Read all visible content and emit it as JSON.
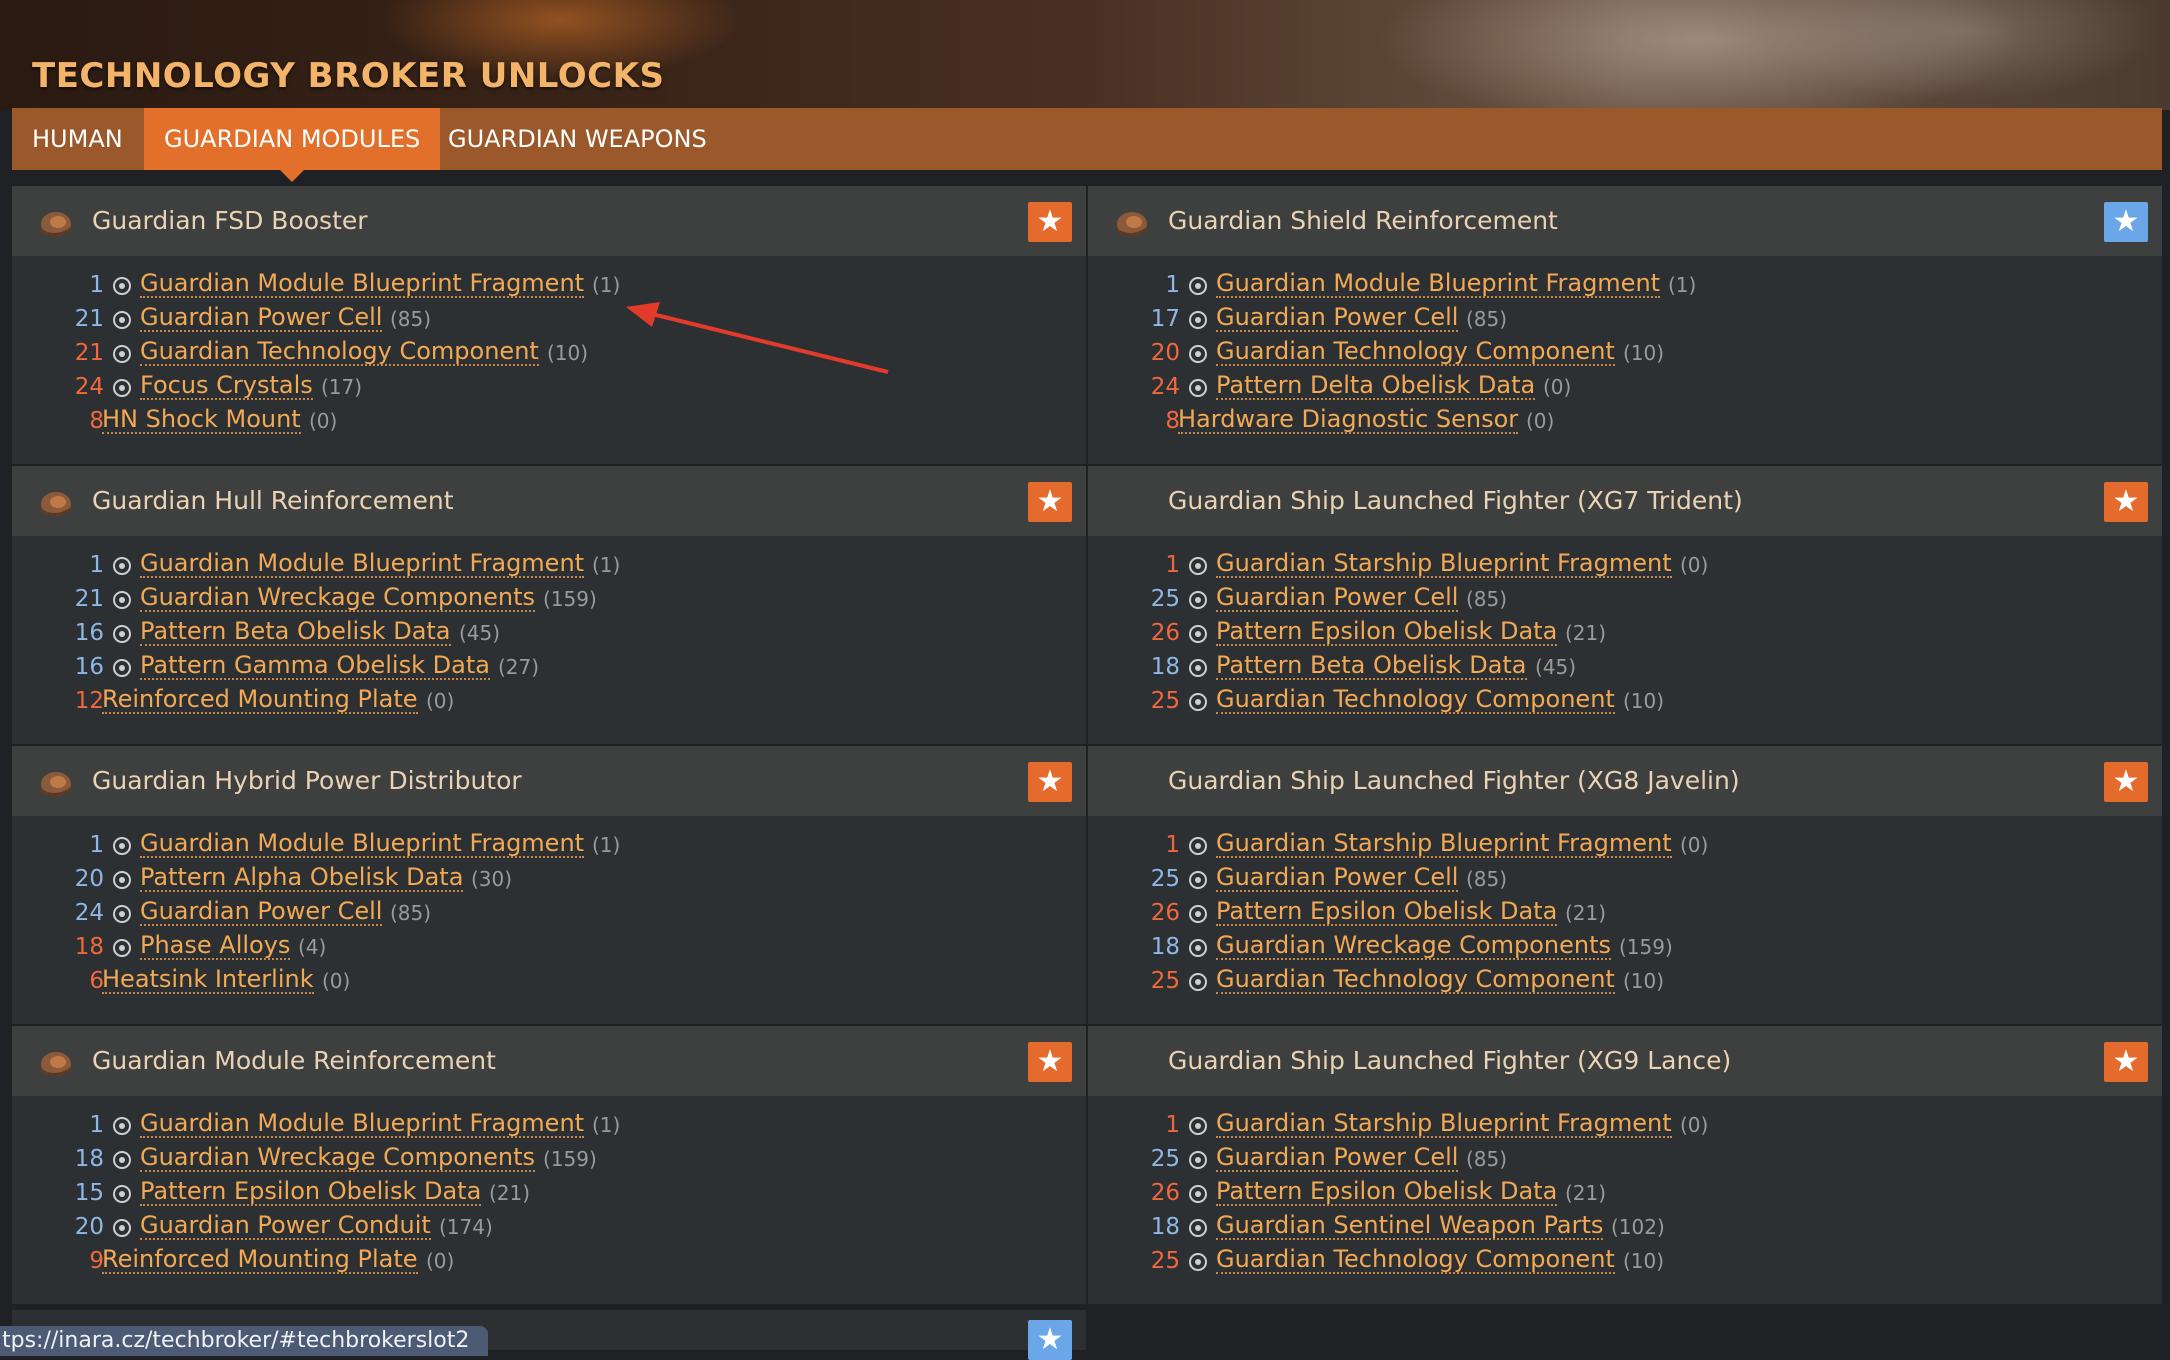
{
  "header": {
    "title": "TECHNOLOGY BROKER UNLOCKS"
  },
  "tabs": [
    {
      "label": "HUMAN",
      "active": false
    },
    {
      "label": "GUARDIAN MODULES",
      "active": true
    },
    {
      "label": "GUARDIAN WEAPONS",
      "active": false
    }
  ],
  "colors": {
    "accent": "#e2702a",
    "tabbar": "#9b582a",
    "link": "#f2a954",
    "qty_short": "#f0683c",
    "qty_ok": "#8fb7e6",
    "star_orange": "#e46b2c",
    "star_blue": "#6aa6e8"
  },
  "panels": [
    {
      "title": "Guardian FSD Booster",
      "star": "orange",
      "pilot_icon": true,
      "materials": [
        {
          "qty": "1",
          "qty_color": "blue",
          "icon": "guardian-fragment-icon",
          "name": "Guardian Module Blueprint Fragment",
          "owned": "(1)"
        },
        {
          "qty": "21",
          "qty_color": "blue",
          "icon": "guardian-cell-icon",
          "name": "Guardian Power Cell",
          "owned": "(85)"
        },
        {
          "qty": "21",
          "qty_color": "red",
          "icon": "guardian-tech-icon",
          "name": "Guardian Technology Component",
          "owned": "(10)"
        },
        {
          "qty": "24",
          "qty_color": "red",
          "icon": "focus-crystals-icon",
          "name": "Focus Crystals",
          "owned": "(17)"
        },
        {
          "qty": "8",
          "qty_color": "red",
          "icon": "",
          "name": "HN Shock Mount",
          "owned": "(0)"
        }
      ]
    },
    {
      "title": "Guardian Shield Reinforcement",
      "star": "blue",
      "pilot_icon": true,
      "materials": [
        {
          "qty": "1",
          "qty_color": "blue",
          "icon": "guardian-fragment-icon",
          "name": "Guardian Module Blueprint Fragment",
          "owned": "(1)"
        },
        {
          "qty": "17",
          "qty_color": "blue",
          "icon": "guardian-cell-icon",
          "name": "Guardian Power Cell",
          "owned": "(85)"
        },
        {
          "qty": "20",
          "qty_color": "red",
          "icon": "guardian-tech-icon",
          "name": "Guardian Technology Component",
          "owned": "(10)"
        },
        {
          "qty": "24",
          "qty_color": "red",
          "icon": "obelisk-data-icon",
          "name": "Pattern Delta Obelisk Data",
          "owned": "(0)"
        },
        {
          "qty": "8",
          "qty_color": "red",
          "icon": "",
          "name": "Hardware Diagnostic Sensor",
          "owned": "(0)"
        }
      ]
    },
    {
      "title": "Guardian Hull Reinforcement",
      "star": "orange",
      "pilot_icon": true,
      "materials": [
        {
          "qty": "1",
          "qty_color": "blue",
          "icon": "guardian-fragment-icon",
          "name": "Guardian Module Blueprint Fragment",
          "owned": "(1)"
        },
        {
          "qty": "21",
          "qty_color": "blue",
          "icon": "guardian-wreckage-icon",
          "name": "Guardian Wreckage Components",
          "owned": "(159)"
        },
        {
          "qty": "16",
          "qty_color": "blue",
          "icon": "obelisk-data-icon",
          "name": "Pattern Beta Obelisk Data",
          "owned": "(45)"
        },
        {
          "qty": "16",
          "qty_color": "blue",
          "icon": "obelisk-data-icon",
          "name": "Pattern Gamma Obelisk Data",
          "owned": "(27)"
        },
        {
          "qty": "12",
          "qty_color": "red",
          "icon": "",
          "name": "Reinforced Mounting Plate",
          "owned": "(0)"
        }
      ]
    },
    {
      "title": "Guardian Ship Launched Fighter (XG7 Trident)",
      "star": "orange",
      "pilot_icon": false,
      "materials": [
        {
          "qty": "1",
          "qty_color": "red",
          "icon": "guardian-fragment-icon",
          "name": "Guardian Starship Blueprint Fragment",
          "owned": "(0)"
        },
        {
          "qty": "25",
          "qty_color": "blue",
          "icon": "guardian-cell-icon",
          "name": "Guardian Power Cell",
          "owned": "(85)"
        },
        {
          "qty": "26",
          "qty_color": "red",
          "icon": "obelisk-data-icon",
          "name": "Pattern Epsilon Obelisk Data",
          "owned": "(21)"
        },
        {
          "qty": "18",
          "qty_color": "blue",
          "icon": "obelisk-data-icon",
          "name": "Pattern Beta Obelisk Data",
          "owned": "(45)"
        },
        {
          "qty": "25",
          "qty_color": "red",
          "icon": "guardian-tech-icon",
          "name": "Guardian Technology Component",
          "owned": "(10)"
        }
      ]
    },
    {
      "title": "Guardian Hybrid Power Distributor",
      "star": "orange",
      "pilot_icon": true,
      "materials": [
        {
          "qty": "1",
          "qty_color": "blue",
          "icon": "guardian-fragment-icon",
          "name": "Guardian Module Blueprint Fragment",
          "owned": "(1)"
        },
        {
          "qty": "20",
          "qty_color": "blue",
          "icon": "obelisk-data-icon",
          "name": "Pattern Alpha Obelisk Data",
          "owned": "(30)"
        },
        {
          "qty": "24",
          "qty_color": "blue",
          "icon": "guardian-cell-icon",
          "name": "Guardian Power Cell",
          "owned": "(85)"
        },
        {
          "qty": "18",
          "qty_color": "red",
          "icon": "phase-alloys-icon",
          "name": "Phase Alloys",
          "owned": "(4)"
        },
        {
          "qty": "6",
          "qty_color": "red",
          "icon": "",
          "name": "Heatsink Interlink",
          "owned": "(0)"
        }
      ]
    },
    {
      "title": "Guardian Ship Launched Fighter (XG8 Javelin)",
      "star": "orange",
      "pilot_icon": false,
      "materials": [
        {
          "qty": "1",
          "qty_color": "red",
          "icon": "guardian-fragment-icon",
          "name": "Guardian Starship Blueprint Fragment",
          "owned": "(0)"
        },
        {
          "qty": "25",
          "qty_color": "blue",
          "icon": "guardian-cell-icon",
          "name": "Guardian Power Cell",
          "owned": "(85)"
        },
        {
          "qty": "26",
          "qty_color": "red",
          "icon": "obelisk-data-icon",
          "name": "Pattern Epsilon Obelisk Data",
          "owned": "(21)"
        },
        {
          "qty": "18",
          "qty_color": "blue",
          "icon": "guardian-wreckage-icon",
          "name": "Guardian Wreckage Components",
          "owned": "(159)"
        },
        {
          "qty": "25",
          "qty_color": "red",
          "icon": "guardian-tech-icon",
          "name": "Guardian Technology Component",
          "owned": "(10)"
        }
      ]
    },
    {
      "title": "Guardian Module Reinforcement",
      "star": "orange",
      "pilot_icon": true,
      "materials": [
        {
          "qty": "1",
          "qty_color": "blue",
          "icon": "guardian-fragment-icon",
          "name": "Guardian Module Blueprint Fragment",
          "owned": "(1)"
        },
        {
          "qty": "18",
          "qty_color": "blue",
          "icon": "guardian-wreckage-icon",
          "name": "Guardian Wreckage Components",
          "owned": "(159)"
        },
        {
          "qty": "15",
          "qty_color": "blue",
          "icon": "obelisk-data-icon",
          "name": "Pattern Epsilon Obelisk Data",
          "owned": "(21)"
        },
        {
          "qty": "20",
          "qty_color": "blue",
          "icon": "guardian-conduit-icon",
          "name": "Guardian Power Conduit",
          "owned": "(174)"
        },
        {
          "qty": "9",
          "qty_color": "red",
          "icon": "",
          "name": "Reinforced Mounting Plate",
          "owned": "(0)"
        }
      ]
    },
    {
      "title": "Guardian Ship Launched Fighter (XG9 Lance)",
      "star": "orange",
      "pilot_icon": false,
      "materials": [
        {
          "qty": "1",
          "qty_color": "red",
          "icon": "guardian-fragment-icon",
          "name": "Guardian Starship Blueprint Fragment",
          "owned": "(0)"
        },
        {
          "qty": "25",
          "qty_color": "blue",
          "icon": "guardian-cell-icon",
          "name": "Guardian Power Cell",
          "owned": "(85)"
        },
        {
          "qty": "26",
          "qty_color": "red",
          "icon": "obelisk-data-icon",
          "name": "Pattern Epsilon Obelisk Data",
          "owned": "(21)"
        },
        {
          "qty": "18",
          "qty_color": "blue",
          "icon": "guardian-weapon-parts-icon",
          "name": "Guardian Sentinel Weapon Parts",
          "owned": "(102)"
        },
        {
          "qty": "25",
          "qty_color": "red",
          "icon": "guardian-tech-icon",
          "name": "Guardian Technology Component",
          "owned": "(10)"
        }
      ]
    }
  ],
  "status_bar": {
    "url": "tps://inara.cz/techbroker/#techbrokerslot2"
  }
}
